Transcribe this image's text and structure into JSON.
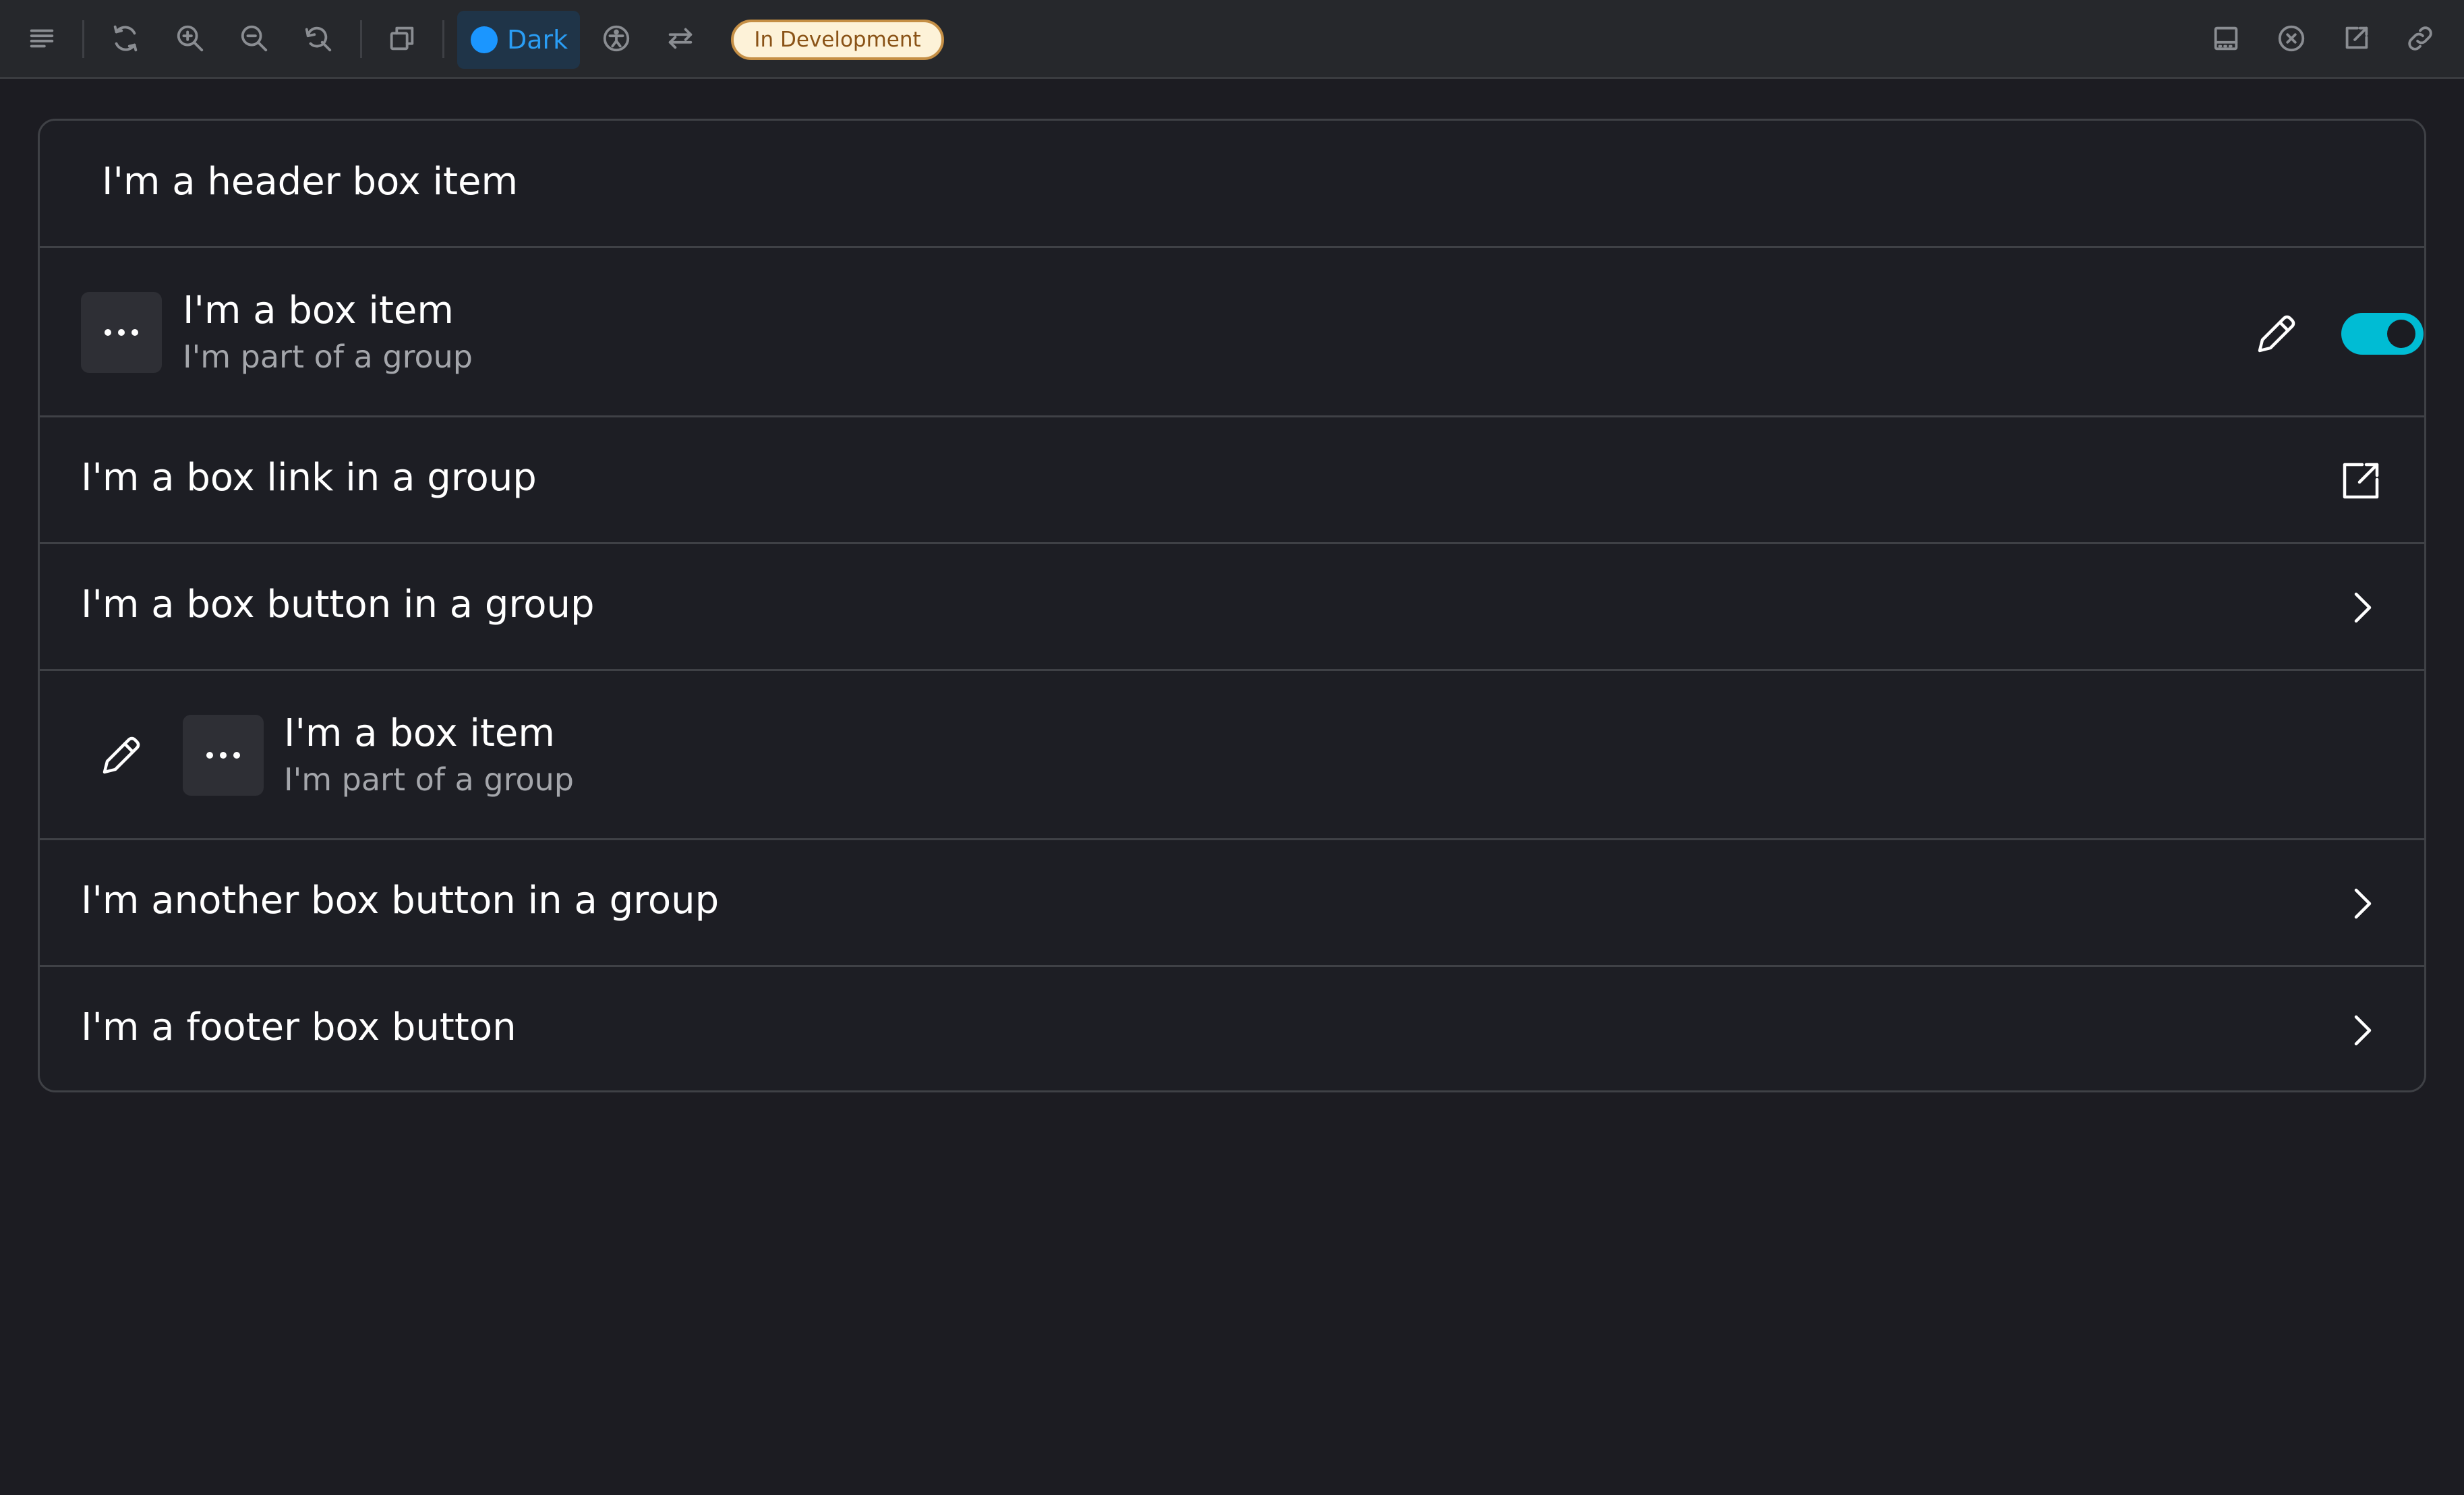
{
  "toolbar": {
    "icons": [
      "menu-icon",
      "rotate-icon",
      "zoom-in-icon",
      "zoom-out-icon",
      "reset-zoom-icon",
      "copy-icon",
      "accessibility-icon",
      "swap-icon",
      "panel-bottom-icon",
      "close-circle-icon",
      "external-link-icon",
      "link-icon"
    ],
    "theme": {
      "label": "Dark",
      "dot_color": "#1b96ff"
    },
    "status_badge": "In Development"
  },
  "box_group": {
    "header": "I'm a header box item",
    "item_1": {
      "title": "I'm a box item",
      "subtitle": "I'm part of a group",
      "toggle_on": true,
      "toggle_color": "#00bcd4"
    },
    "link": {
      "label": "I'm a box link in a group"
    },
    "button_1": {
      "label": "I'm a box button in a group"
    },
    "item_2": {
      "title": "I'm a box item",
      "subtitle": "I'm part of a group"
    },
    "button_2": {
      "label": "I'm another box button in a group"
    },
    "footer_button": {
      "label": "I'm a footer box button"
    }
  }
}
